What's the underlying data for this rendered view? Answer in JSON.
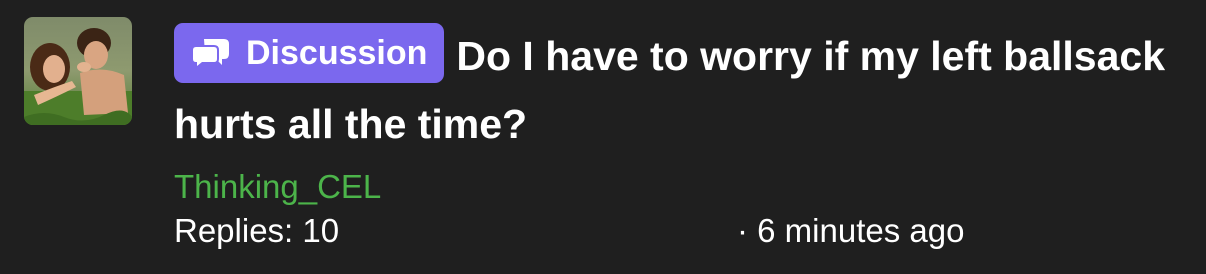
{
  "thread": {
    "prefix": {
      "label": "Discussion",
      "icon": "chat-bubbles-icon",
      "color": "#7b68ee"
    },
    "title": "Do I have to worry if my left ballsack hurts all the time?",
    "author": "Thinking_CEL",
    "author_color": "#4cb44a",
    "replies": "Replies: 10",
    "time": "· 6 minutes ago"
  }
}
